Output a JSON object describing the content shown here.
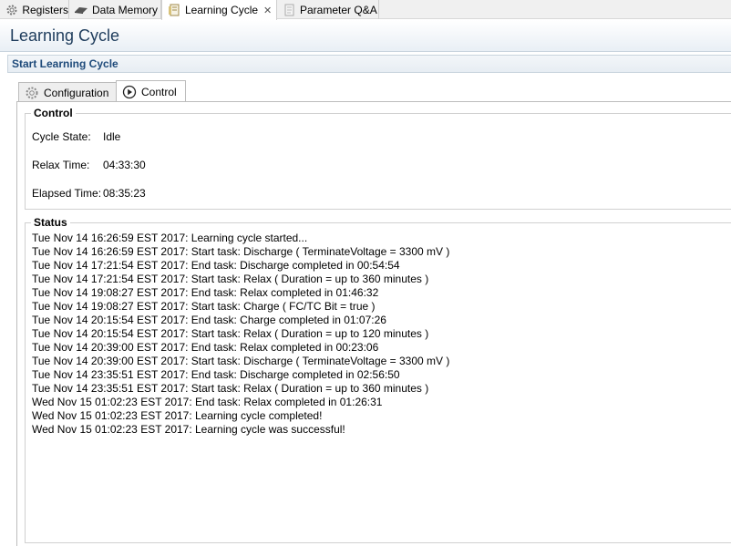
{
  "editor_tabs": [
    {
      "label": "Registers",
      "icon": "gear-icon"
    },
    {
      "label": "Data Memory",
      "icon": "memory-chip-icon"
    },
    {
      "label": "Learning Cycle",
      "icon": "document-icon",
      "close": "✕"
    },
    {
      "label": "Parameter Q&A",
      "icon": "document-icon"
    }
  ],
  "page": {
    "title": "Learning Cycle"
  },
  "section": {
    "title": "Start Learning Cycle"
  },
  "inner_tabs": [
    {
      "label": "Configuration",
      "icon": "gear-icon"
    },
    {
      "label": "Control",
      "icon": "play-icon"
    }
  ],
  "control": {
    "title": "Control",
    "fields": [
      {
        "label": "Cycle State:",
        "value": "Idle"
      },
      {
        "label": "Relax Time:",
        "value": "04:33:30"
      },
      {
        "label": "Elapsed Time:",
        "value": "08:35:23"
      }
    ]
  },
  "status": {
    "title": "Status",
    "lines": [
      "Tue Nov 14 16:26:59 EST 2017: Learning cycle started...",
      "Tue Nov 14 16:26:59 EST 2017: Start task: Discharge ( TerminateVoltage = 3300 mV )",
      "Tue Nov 14 17:21:54 EST 2017: End task: Discharge completed in 00:54:54",
      "Tue Nov 14 17:21:54 EST 2017: Start task: Relax ( Duration = up to 360 minutes )",
      "Tue Nov 14 19:08:27 EST 2017: End task: Relax completed in 01:46:32",
      "Tue Nov 14 19:08:27 EST 2017: Start task: Charge ( FC/TC Bit = true )",
      "Tue Nov 14 20:15:54 EST 2017: End task: Charge completed in 01:07:26",
      "Tue Nov 14 20:15:54 EST 2017: Start task: Relax ( Duration = up to 120 minutes )",
      "Tue Nov 14 20:39:00 EST 2017: End task: Relax completed in 00:23:06",
      "Tue Nov 14 20:39:00 EST 2017: Start task: Discharge ( TerminateVoltage = 3300 mV )",
      "Tue Nov 14 23:35:51 EST 2017: End task: Discharge completed in 02:56:50",
      "Tue Nov 14 23:35:51 EST 2017: Start task: Relax ( Duration = up to 360 minutes )",
      "Wed Nov 15 01:02:23 EST 2017: End task: Relax completed in 01:26:31",
      "Wed Nov 15 01:02:23 EST 2017: Learning cycle completed!",
      "Wed Nov 15 01:02:23 EST 2017: Learning cycle was successful!"
    ]
  }
}
